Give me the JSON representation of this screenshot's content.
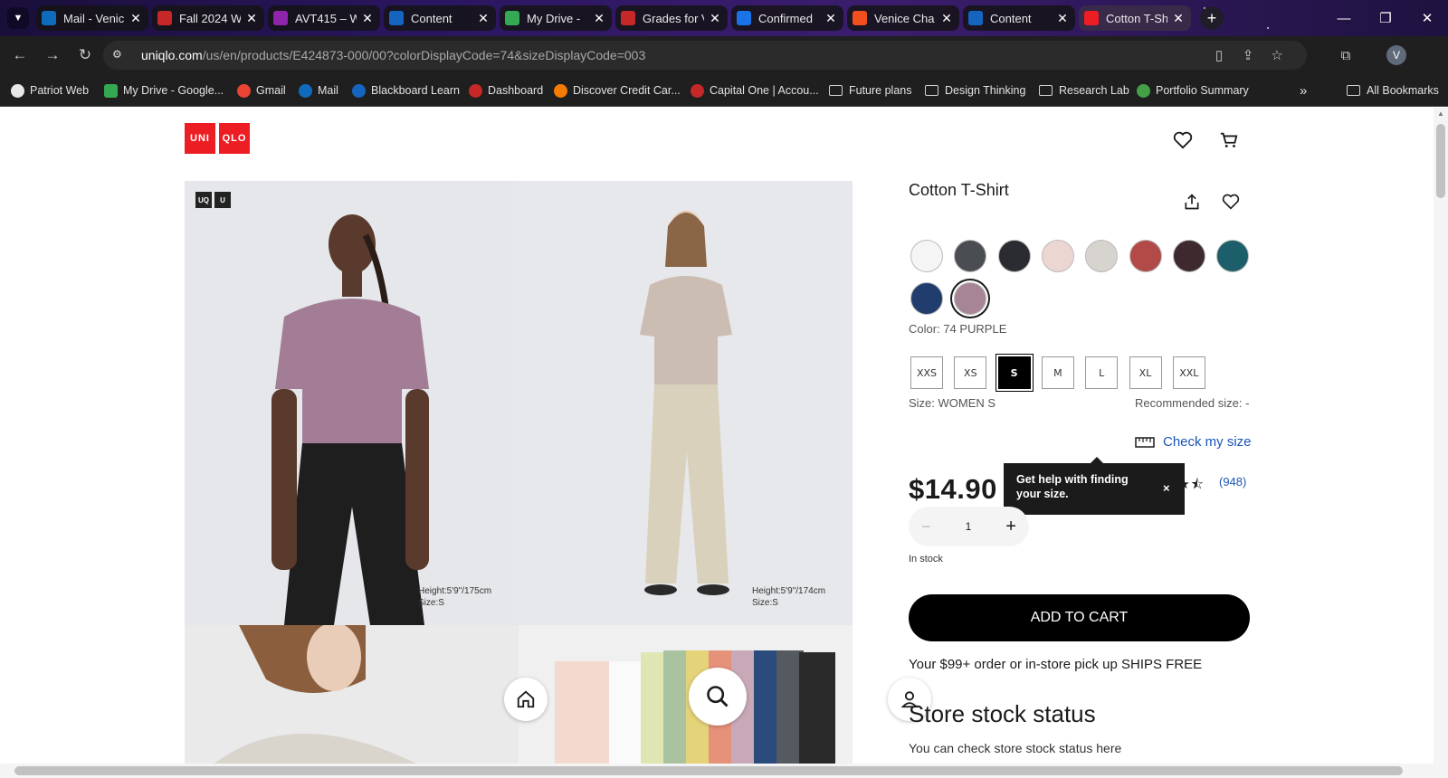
{
  "browser": {
    "tabs": [
      {
        "label": "Mail - Venic",
        "favicon": "outlook-icon",
        "color": "#0f6cbd"
      },
      {
        "label": "Fall 2024 W",
        "favicon": "dashed-circle-icon",
        "color": "#c62828"
      },
      {
        "label": "AVT415 – W",
        "favicon": "gradient-square-icon",
        "color": "#8e24aa"
      },
      {
        "label": "Content",
        "favicon": "blackboard-icon",
        "color": "#1565c0"
      },
      {
        "label": "My Drive -",
        "favicon": "drive-icon",
        "color": "#34a853"
      },
      {
        "label": "Grades for V",
        "favicon": "dashed-circle-icon",
        "color": "#c62828"
      },
      {
        "label": "Confirmed",
        "favicon": "circle-c-icon",
        "color": "#1a73e8"
      },
      {
        "label": "Venice Cha",
        "favicon": "figma-icon",
        "color": "#f24e1e"
      },
      {
        "label": "Content",
        "favicon": "blackboard-icon",
        "color": "#1565c0"
      },
      {
        "label": "Cotton T-Sh",
        "favicon": "uniqlo-icon",
        "color": "#ed1d24"
      }
    ],
    "url_host": "uniqlo.com",
    "url_path": "/us/en/products/E424873-000/00?colorDisplayCode=74&sizeDisplayCode=003",
    "profile_initial": "V",
    "bookmarks": [
      {
        "label": "Patriot Web",
        "icon": "patriot-icon"
      },
      {
        "label": "My Drive - Google...",
        "icon": "drive-icon"
      },
      {
        "label": "Gmail",
        "icon": "google-icon"
      },
      {
        "label": "Mail",
        "icon": "outlook-icon"
      },
      {
        "label": "Blackboard Learn",
        "icon": "blackboard-icon"
      },
      {
        "label": "Dashboard",
        "icon": "dashed-circle-icon"
      },
      {
        "label": "Discover Credit Car...",
        "icon": "discover-icon"
      },
      {
        "label": "Capital One | Accou...",
        "icon": "capital-one-icon"
      },
      {
        "label": "Future plans",
        "icon": "folder-icon"
      },
      {
        "label": "Design Thinking",
        "icon": "folder-icon"
      },
      {
        "label": "Research Lab",
        "icon": "folder-icon"
      },
      {
        "label": "Portfolio Summary",
        "icon": "portfolio-icon"
      }
    ],
    "bookmarks_overflow": "»",
    "all_bookmarks": "All Bookmarks"
  },
  "site": {
    "logo_top": "UNI",
    "logo_bottom": "QLO",
    "badge_1": "UQ",
    "badge_2": "U"
  },
  "gallery": {
    "caption_1_height": "Height:5'9\"/175cm",
    "caption_1_size": "Size:S",
    "caption_2_height": "Height:5'9\"/174cm",
    "caption_2_size": "Size:S"
  },
  "product": {
    "title": "Cotton T-Shirt",
    "colors": [
      "#f5f5f6",
      "#4a4e52",
      "#2a2c31",
      "#ecd6d2",
      "#d7d3cf",
      "#b24a47",
      "#3e2a2e",
      "#1c5e6a",
      "#213d6e",
      "#a78596"
    ],
    "selected_color_index": 9,
    "color_label": "Color: 74 PURPLE",
    "sizes": [
      "XXS",
      "XS",
      "S",
      "M",
      "L",
      "XL",
      "XXL"
    ],
    "selected_size_index": 2,
    "size_label": "Size: WOMEN S",
    "recommended_size": "Recommended size: -",
    "check_size": "Check my size",
    "price": "$14.90",
    "tooltip": "Get help with finding your size.",
    "tooltip_close": "×",
    "rating": 4.5,
    "stars": "★★★★⯪",
    "reviews": "(948)",
    "quantity": "1",
    "qty_minus": "−",
    "qty_plus": "+",
    "stock": "In stock",
    "add_to_cart": "ADD TO CART",
    "shipping": "Your $99+ order or in-store pick up SHIPS FREE",
    "store_heading": "Store stock status",
    "store_sub": "You can check store stock status here"
  }
}
